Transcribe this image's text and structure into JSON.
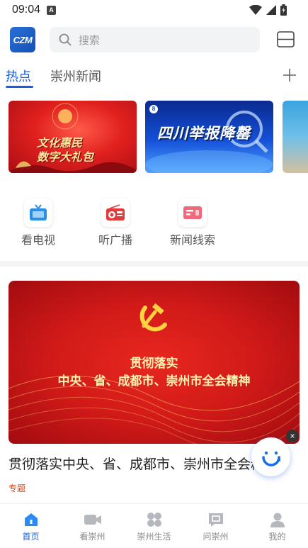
{
  "status_bar": {
    "time": "09:04",
    "notification_letter": "A"
  },
  "header": {
    "logo_text": "CZM",
    "search_placeholder": "搜索"
  },
  "tabs": [
    {
      "label": "热点",
      "active": true
    },
    {
      "label": "崇州新闻",
      "active": false
    }
  ],
  "banners": [
    {
      "line1": "文化惠民",
      "line2": "数字大礼包"
    },
    {
      "title": "四川举报降罄",
      "badge": "8"
    },
    {
      "title": ""
    }
  ],
  "quick_entries": [
    {
      "label": "看电视",
      "icon": "tv-icon"
    },
    {
      "label": "听广播",
      "icon": "radio-icon"
    },
    {
      "label": "新闻线索",
      "icon": "news-tip-icon"
    }
  ],
  "feature": {
    "image_line1": "贯彻落实",
    "image_line2": "中央、省、成都市、崇州市全会精神",
    "title": "贯彻落实中央、省、成都市、崇州市全会精神",
    "tag": "专题",
    "tag_color": "#d2461f"
  },
  "bottom_nav": [
    {
      "label": "首页",
      "icon": "home-icon",
      "active": true
    },
    {
      "label": "看崇州",
      "icon": "video-camera-icon",
      "active": false
    },
    {
      "label": "崇州生活",
      "icon": "grid-apps-icon",
      "active": false
    },
    {
      "label": "问崇州",
      "icon": "question-chat-icon",
      "active": false
    },
    {
      "label": "我的",
      "icon": "user-icon",
      "active": false
    }
  ],
  "colors": {
    "accent": "#1a5fd8",
    "banner_red": "#e0201e",
    "banner_blue": "#1450d8"
  }
}
